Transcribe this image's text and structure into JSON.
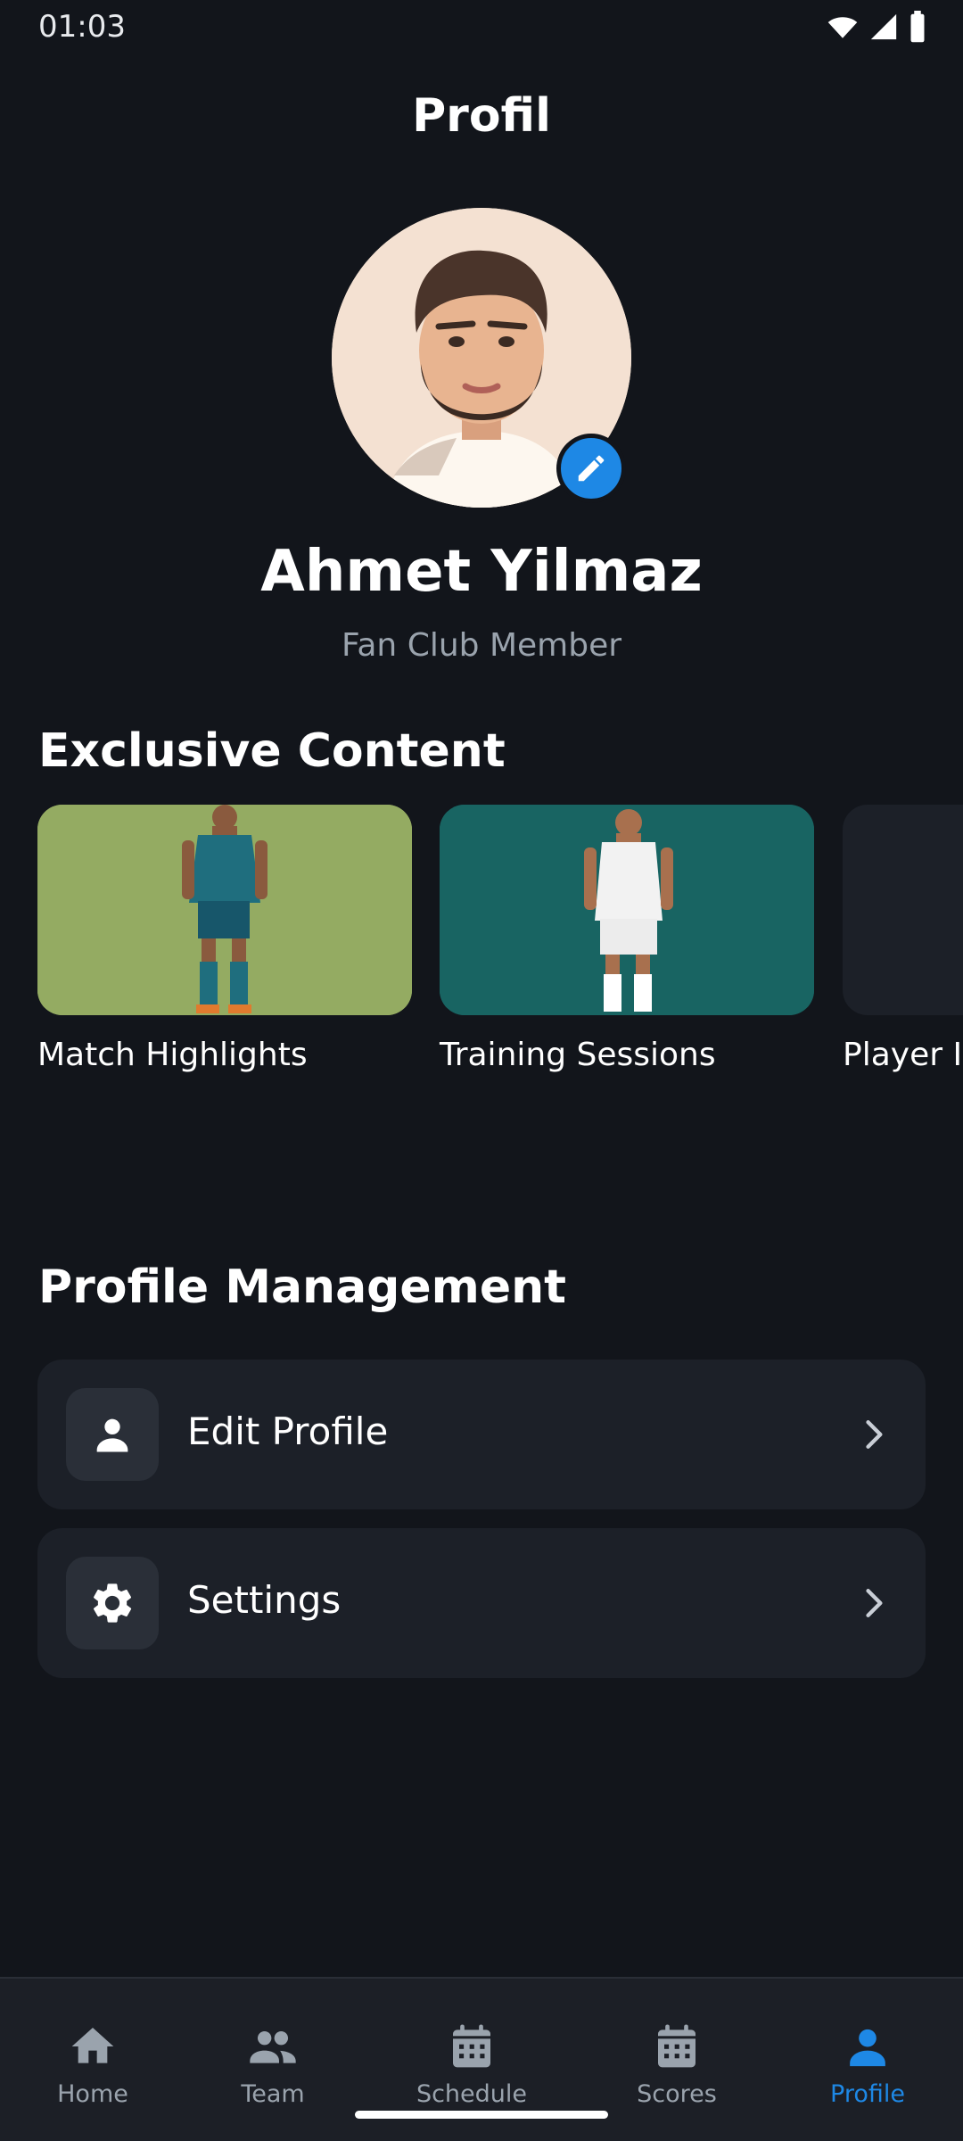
{
  "status_bar": {
    "time": "01:03"
  },
  "header": {
    "title": "Profil"
  },
  "profile": {
    "name": "Ahmet Yilmaz",
    "role": "Fan Club Member"
  },
  "exclusive": {
    "title": "Exclusive Content",
    "cards": [
      {
        "label": "Match Highlights",
        "bg": "#94ab62"
      },
      {
        "label": "Training Sessions",
        "bg": "#186462"
      },
      {
        "label": "Player I",
        "bg": "#1c2028"
      }
    ]
  },
  "management": {
    "title": "Profile Management",
    "items": [
      {
        "label": "Edit Profile",
        "icon": "person-icon"
      },
      {
        "label": "Settings",
        "icon": "gear-icon"
      }
    ]
  },
  "nav": {
    "items": [
      {
        "label": "Home",
        "icon": "home-icon"
      },
      {
        "label": "Team",
        "icon": "team-icon"
      },
      {
        "label": "Schedule",
        "icon": "calendar-icon"
      },
      {
        "label": "Scores",
        "icon": "calendar-icon"
      },
      {
        "label": "Profile",
        "icon": "person-icon",
        "active": true
      }
    ]
  },
  "colors": {
    "accent": "#1e88e5",
    "background": "#12151b",
    "card": "#1c2028",
    "muted": "#9aa3ad"
  }
}
